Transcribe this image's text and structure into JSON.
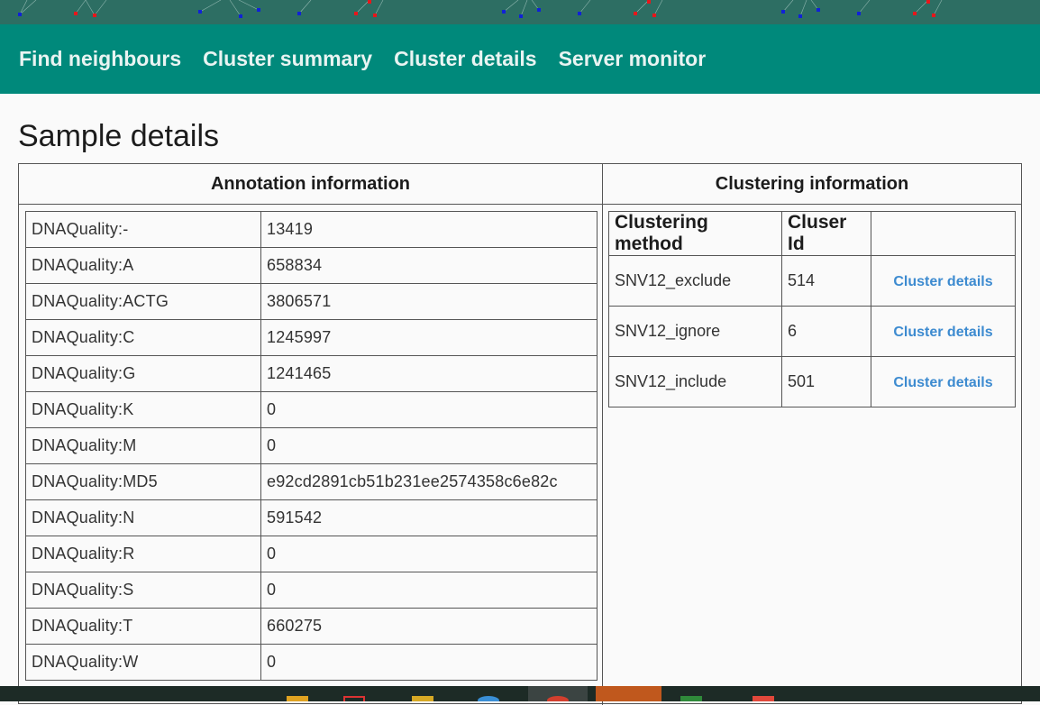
{
  "nav": {
    "items": [
      "Find neighbours",
      "Cluster summary",
      "Cluster details",
      "Server monitor"
    ]
  },
  "page": {
    "title": "Sample details"
  },
  "annotation": {
    "header": "Annotation information",
    "rows": [
      {
        "key": "DNAQuality:-",
        "value": "13419"
      },
      {
        "key": "DNAQuality:A",
        "value": "658834"
      },
      {
        "key": "DNAQuality:ACTG",
        "value": "3806571"
      },
      {
        "key": "DNAQuality:C",
        "value": "1245997"
      },
      {
        "key": "DNAQuality:G",
        "value": "1241465"
      },
      {
        "key": "DNAQuality:K",
        "value": "0"
      },
      {
        "key": "DNAQuality:M",
        "value": "0"
      },
      {
        "key": "DNAQuality:MD5",
        "value": "e92cd2891cb51b231ee2574358c6e82c"
      },
      {
        "key": "DNAQuality:N",
        "value": "591542"
      },
      {
        "key": "DNAQuality:R",
        "value": "0"
      },
      {
        "key": "DNAQuality:S",
        "value": "0"
      },
      {
        "key": "DNAQuality:T",
        "value": "660275"
      },
      {
        "key": "DNAQuality:W",
        "value": "0"
      }
    ]
  },
  "clustering": {
    "header": "Clustering information",
    "columns": [
      "Clustering method",
      "Cluser Id",
      ""
    ],
    "rows": [
      {
        "method": "SNV12_exclude",
        "id": "514",
        "link": "Cluster details"
      },
      {
        "method": "SNV12_ignore",
        "id": "6",
        "link": "Cluster details"
      },
      {
        "method": "SNV12_include",
        "id": "501",
        "link": "Cluster details"
      }
    ]
  },
  "colors": {
    "banner": "#2d6e63",
    "nav_bg": "#00897b",
    "link": "#3d8bd0",
    "node_red": "#e8161b",
    "node_blue": "#1021d8"
  }
}
